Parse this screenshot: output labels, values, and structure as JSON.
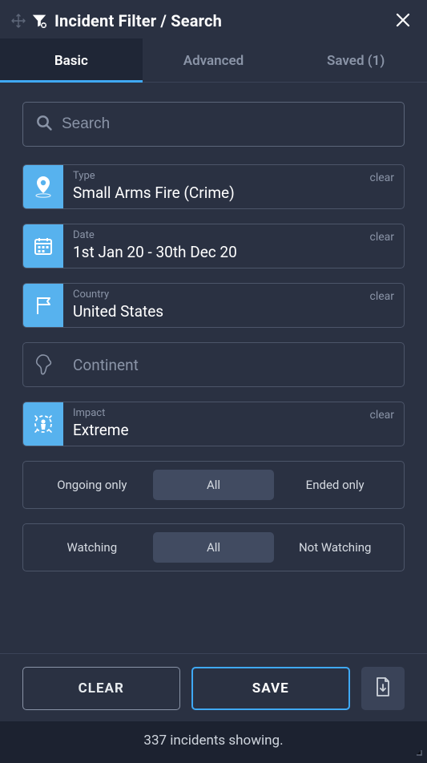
{
  "header": {
    "title": "Incident Filter / Search"
  },
  "tabs": {
    "basic": "Basic",
    "advanced": "Advanced",
    "saved": "Saved (1)"
  },
  "search": {
    "placeholder": "Search",
    "value": ""
  },
  "fields": {
    "type": {
      "label": "Type",
      "value": "Small Arms Fire (Crime)",
      "clear": "clear"
    },
    "date": {
      "label": "Date",
      "value": "1st Jan 20 - 30th Dec 20",
      "clear": "clear"
    },
    "country": {
      "label": "Country",
      "value": "United States",
      "clear": "clear"
    },
    "continent": {
      "placeholder": "Continent"
    },
    "impact": {
      "label": "Impact",
      "value": "Extreme",
      "clear": "clear"
    }
  },
  "status_filter": {
    "ongoing": "Ongoing only",
    "all": "All",
    "ended": "Ended only"
  },
  "watch_filter": {
    "watching": "Watching",
    "all": "All",
    "not": "Not Watching"
  },
  "buttons": {
    "clear": "CLEAR",
    "save": "SAVE"
  },
  "footer": {
    "status": "337 incidents showing."
  }
}
